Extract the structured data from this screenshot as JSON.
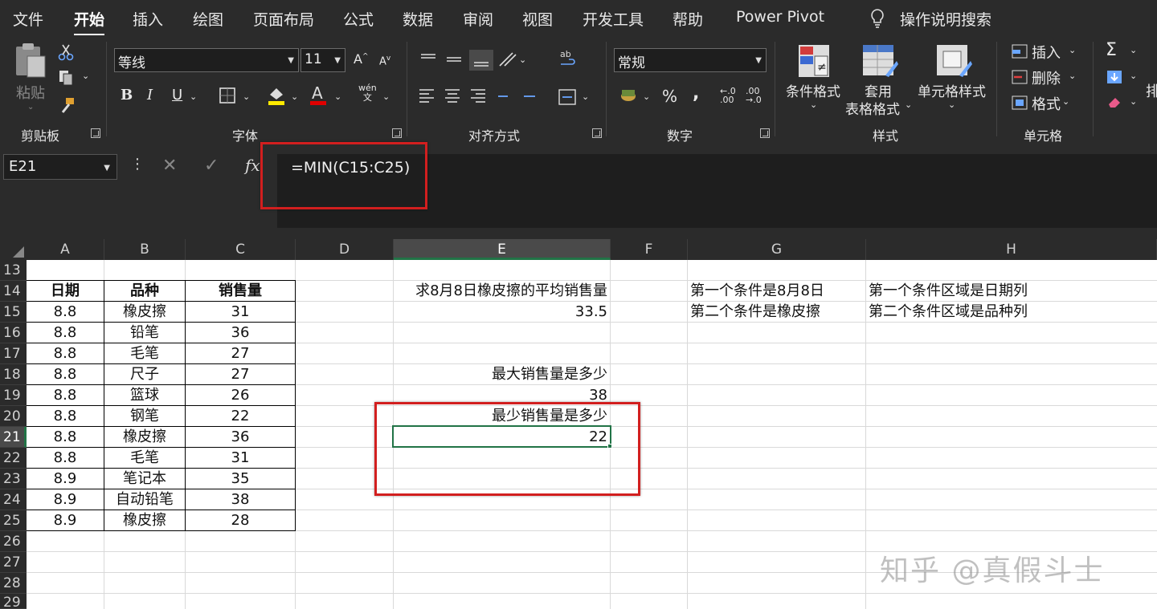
{
  "menu": {
    "tabs": [
      "文件",
      "开始",
      "插入",
      "绘图",
      "页面布局",
      "公式",
      "数据",
      "审阅",
      "视图",
      "开发工具",
      "帮助",
      "Power Pivot"
    ],
    "active_tab": "开始",
    "tell_me": "操作说明搜索"
  },
  "ribbon": {
    "clipboard": {
      "paste": "粘贴",
      "label": "剪贴板"
    },
    "font": {
      "name": "等线",
      "size": "11",
      "label": "字体",
      "phonetic": "wén\n文"
    },
    "alignment": {
      "label": "对齐方式"
    },
    "number": {
      "format": "常规",
      "label": "数字"
    },
    "styles": {
      "conditional": "条件格式",
      "table_line1": "套用",
      "table_line2": "表格格式",
      "cell_styles": "单元格样式",
      "label": "样式"
    },
    "cells": {
      "insert": "插入",
      "delete": "删除",
      "format": "格式",
      "label": "单元格"
    },
    "editing": {
      "sort_partial": "排"
    }
  },
  "formula_bar": {
    "name_box": "E21",
    "fx": "fx",
    "formula": "=MIN(C15:C25)"
  },
  "grid": {
    "columns": [
      "A",
      "B",
      "C",
      "D",
      "E",
      "F",
      "G",
      "H"
    ],
    "selected_column": "E",
    "rows": [
      "13",
      "14",
      "15",
      "16",
      "17",
      "18",
      "19",
      "20",
      "21",
      "22",
      "23",
      "24",
      "25",
      "26",
      "27",
      "28",
      "29"
    ],
    "selected_row": "21",
    "table_header": [
      "日期",
      "品种",
      "销售量"
    ],
    "table_rows": [
      [
        "8.8",
        "橡皮擦",
        "31"
      ],
      [
        "8.8",
        "铅笔",
        "36"
      ],
      [
        "8.8",
        "毛笔",
        "27"
      ],
      [
        "8.8",
        "尺子",
        "27"
      ],
      [
        "8.8",
        "篮球",
        "26"
      ],
      [
        "8.8",
        "钢笔",
        "22"
      ],
      [
        "8.8",
        "橡皮擦",
        "36"
      ],
      [
        "8.8",
        "毛笔",
        "31"
      ],
      [
        "8.9",
        "笔记本",
        "35"
      ],
      [
        "8.9",
        "自动铅笔",
        "38"
      ],
      [
        "8.9",
        "橡皮擦",
        "28"
      ]
    ],
    "e_cells": {
      "e14": "求8月8日橡皮擦的平均销售量",
      "e15": "33.5",
      "e18": "最大销售量是多少",
      "e19": "38",
      "e20": "最少销售量是多少",
      "e21": "22"
    },
    "g14": "第一个条件是8月8日",
    "g15": "第二个条件是橡皮擦",
    "h14": "第一个条件区域是日期列",
    "h15": "第二个条件区域是品种列"
  },
  "watermark": "知乎 @真假斗士",
  "colors": {
    "accent": "#217346",
    "highlight": "#d21f1f",
    "ribbon_bg": "#2b2b2b"
  }
}
